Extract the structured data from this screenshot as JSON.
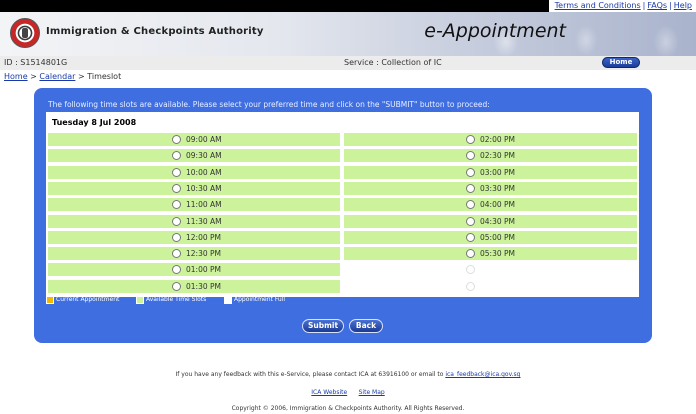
{
  "toplinks": {
    "terms": "Terms and Conditions",
    "faqs": "FAQs",
    "help": "Help",
    "sep": "|"
  },
  "header": {
    "org_name": "Immigration & Checkpoints Authority",
    "app_title": "e-Appointment"
  },
  "infobar": {
    "id": "ID : S1514801G",
    "service": "Service : Collection of IC",
    "home_button": "Home"
  },
  "breadcrumb": {
    "home": "Home",
    "calendar": "Calendar",
    "current": "> Timeslot",
    "sep": ">"
  },
  "panel": {
    "instruction": "The following time slots are available. Please select your preferred time and click on the \"SUBMIT\" button to proceed:",
    "date": "Tuesday 8 Jul 2008"
  },
  "slots_left": [
    {
      "time": "09:00 AM",
      "available": true
    },
    {
      "time": "09:30 AM",
      "available": true
    },
    {
      "time": "10:00 AM",
      "available": true
    },
    {
      "time": "10:30 AM",
      "available": true
    },
    {
      "time": "11:00 AM",
      "available": true
    },
    {
      "time": "11:30 AM",
      "available": true
    },
    {
      "time": "12:00 PM",
      "available": true
    },
    {
      "time": "12:30 PM",
      "available": true
    },
    {
      "time": "01:00 PM",
      "available": true
    },
    {
      "time": "01:30 PM",
      "available": true
    }
  ],
  "slots_right": [
    {
      "time": "02:00 PM",
      "available": true
    },
    {
      "time": "02:30 PM",
      "available": true
    },
    {
      "time": "03:00 PM",
      "available": true
    },
    {
      "time": "03:30 PM",
      "available": true
    },
    {
      "time": "04:00 PM",
      "available": true
    },
    {
      "time": "04:30 PM",
      "available": true
    },
    {
      "time": "05:00 PM",
      "available": true
    },
    {
      "time": "05:30 PM",
      "available": true
    },
    {
      "time": "",
      "available": false
    },
    {
      "time": "",
      "available": false
    }
  ],
  "legend": {
    "current": "Current Appointment",
    "available": "Available Time Slots",
    "full": "Appointment Full",
    "colors": {
      "current": "#f5b800",
      "available": "#ccf39b",
      "full": "#ffffff"
    }
  },
  "buttons": {
    "submit": "Submit",
    "back": "Back"
  },
  "footer": {
    "feedback_text": "If you have any feedback with this e-Service, please contact ICA at 63916100 or email to",
    "feedback_email": "ica_feedback@ica.gov.sg",
    "ica_website": "ICA Website",
    "sitemap": "Site Map",
    "copyright": "Copyright © 2006, Immigration & Checkpoints Authority. All Rights Reserved."
  },
  "colors": {
    "panel": "#3f6ee0",
    "available_slot": "#ccf39b",
    "link": "#1a3aa8"
  }
}
